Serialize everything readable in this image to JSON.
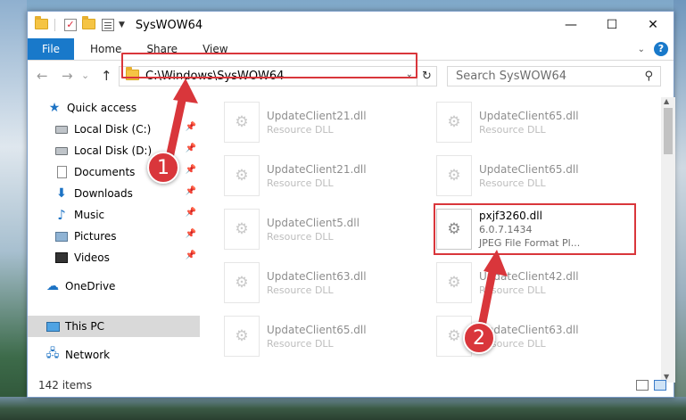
{
  "window": {
    "title": "SysWOW64",
    "controls": [
      "—",
      "☐",
      "✕"
    ]
  },
  "ribbon": {
    "tabs": [
      "File",
      "Home",
      "Share",
      "View"
    ],
    "help": "?"
  },
  "nav": {
    "back": "←",
    "forward": "→",
    "recent": "⌄",
    "up": "↑"
  },
  "address": {
    "path": "C:\\Windows\\SysWOW64",
    "refresh": "↻"
  },
  "search": {
    "placeholder": "Search SysWOW64"
  },
  "sidebar": {
    "items": [
      {
        "label": "Quick access",
        "icon": "star-icon",
        "pinned": false
      },
      {
        "label": "Local Disk (C:)",
        "icon": "disk-icon",
        "pinned": true
      },
      {
        "label": "Local Disk (D:)",
        "icon": "disk-icon",
        "pinned": true
      },
      {
        "label": "Documents",
        "icon": "document-icon",
        "pinned": true
      },
      {
        "label": "Downloads",
        "icon": "download-icon",
        "pinned": true
      },
      {
        "label": "Music",
        "icon": "music-icon",
        "pinned": true
      },
      {
        "label": "Pictures",
        "icon": "pictures-icon",
        "pinned": true
      },
      {
        "label": "Videos",
        "icon": "videos-icon",
        "pinned": true
      },
      {
        "label": "OneDrive",
        "icon": "cloud-icon",
        "pinned": false
      },
      {
        "label": "This PC",
        "icon": "computer-icon",
        "pinned": false,
        "selected": true
      },
      {
        "label": "Network",
        "icon": "network-icon",
        "pinned": false
      }
    ]
  },
  "files": [
    {
      "name": "UpdateClient21.dll",
      "sub": "Resource DLL",
      "faded": true
    },
    {
      "name": "UpdateClient65.dll",
      "sub": "Resource DLL",
      "faded": true
    },
    {
      "name": "UpdateClient21.dll",
      "sub": "Resource DLL",
      "faded": true
    },
    {
      "name": "UpdateClient65.dll",
      "sub": "Resource DLL",
      "faded": true
    },
    {
      "name": "UpdateClient5.dll",
      "sub": "Resource DLL",
      "faded": true
    },
    {
      "name": "pxjf3260.dll",
      "sub": "6.0.7.1434",
      "sub2": "JPEG File Format Pl...",
      "faded": false
    },
    {
      "name": "UpdateClient63.dll",
      "sub": "Resource DLL",
      "faded": true
    },
    {
      "name": "UpdateClient42.dll",
      "sub": "Resource DLL",
      "faded": true
    },
    {
      "name": "UpdateClient65.dll",
      "sub": "Resource DLL",
      "faded": true
    },
    {
      "name": "UpdateClient63.dll",
      "sub": "Resource DLL",
      "faded": true
    }
  ],
  "status": {
    "count": "142 items"
  },
  "annotations": {
    "badge1": "1",
    "badge2": "2",
    "color": "#d9363b"
  }
}
